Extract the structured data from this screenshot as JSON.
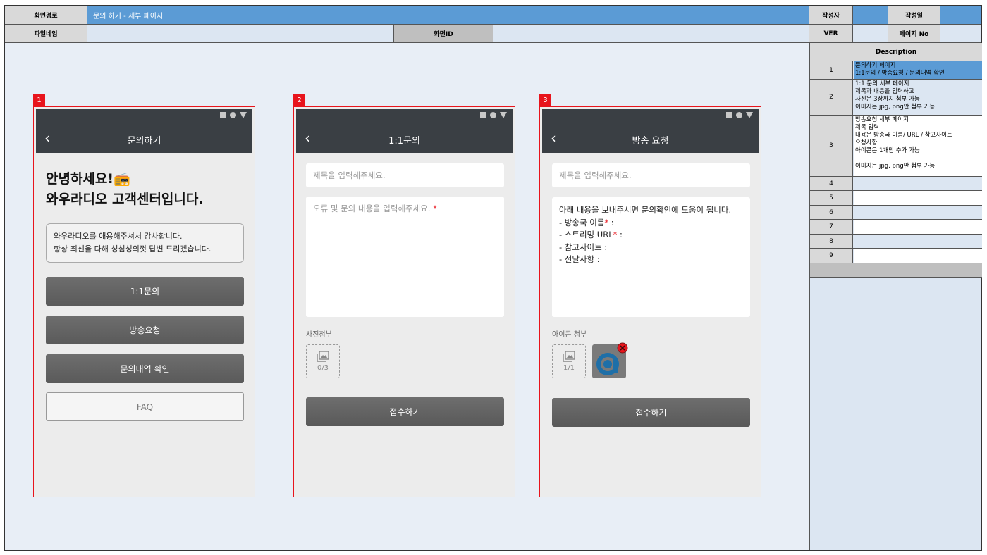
{
  "header": {
    "screen_path_label": "화면경로",
    "screen_path_value": "문의 하기 - 세부 페이지",
    "author_label": "작성자",
    "author_value": "",
    "date_label": "작성일",
    "date_value": "",
    "filename_label": "파일네임",
    "filename_value": "",
    "screen_id_label": "화면ID",
    "screen_id_value": "",
    "ver_label": "VER",
    "ver_value": "",
    "page_no_label": "페이지 No",
    "page_no_value": ""
  },
  "description": {
    "title": "Description",
    "rows": [
      {
        "num": "1",
        "text": "문의하기 페이지\n1:1문의 / 방송요청 / 문의내역 확인"
      },
      {
        "num": "2",
        "text": "1:1 문의 세부 페이지\n제목과 내용을 입력하고\n사진은 3장까지 첨부 가능\n이미지는 jpg, png만 첨부 가능"
      },
      {
        "num": "3",
        "text": "방송요청 세부 페이지\n제목 입력\n내용은 방송국 이름/ URL / 참고사이트\n요청사항\n아이콘은 1개만 추가 가능\n\n이미지는 jpg, png만 첨부 가능"
      },
      {
        "num": "4",
        "text": ""
      },
      {
        "num": "5",
        "text": ""
      },
      {
        "num": "6",
        "text": ""
      },
      {
        "num": "7",
        "text": ""
      },
      {
        "num": "8",
        "text": ""
      },
      {
        "num": "9",
        "text": ""
      }
    ]
  },
  "screens": {
    "s1": {
      "tag": "1",
      "title": "문의하기",
      "greeting_line1": "안녕하세요!📻",
      "greeting_line2": "와우라디오 고객센터입니다.",
      "notice_line1": "와우라디오를 애용해주셔서 감사합니다.",
      "notice_line2": "항상 최선을 다해 성심성의껏 답변 드리겠습니다.",
      "btn_inquiry": "1:1문의",
      "btn_broadcast": "방송요청",
      "btn_history": "문의내역 확인",
      "btn_faq": "FAQ"
    },
    "s2": {
      "tag": "2",
      "title": "1:1문의",
      "title_placeholder": "제목을 입력해주세요.",
      "content_placeholder": "오류 및 문의 내용을 입력해주세요.",
      "required_mark": "*",
      "attach_label": "사진첨부",
      "attach_count": "0/3",
      "submit": "접수하기"
    },
    "s3": {
      "tag": "3",
      "title": "방송 요청",
      "title_placeholder": "제목을 입력해주세요.",
      "guide_intro": "아래 내용을 보내주시면 문의확인에 도움이 됩니다.",
      "guide_item1": " - 방송국 이름",
      "guide_item2": " - 스트리밍 URL",
      "guide_item3": " - 참고사이트 :",
      "guide_item4": " - 전달사항 :",
      "required_mark": "*",
      "colon": " :",
      "attach_label": "아이콘 첨부",
      "attach_count": "1/1",
      "submit": "접수하기"
    }
  },
  "colors": {
    "accent_blue": "#5b9bd5",
    "light_blue": "#dce6f2",
    "red_border": "#e8141c",
    "appbar": "#3a3f44"
  }
}
